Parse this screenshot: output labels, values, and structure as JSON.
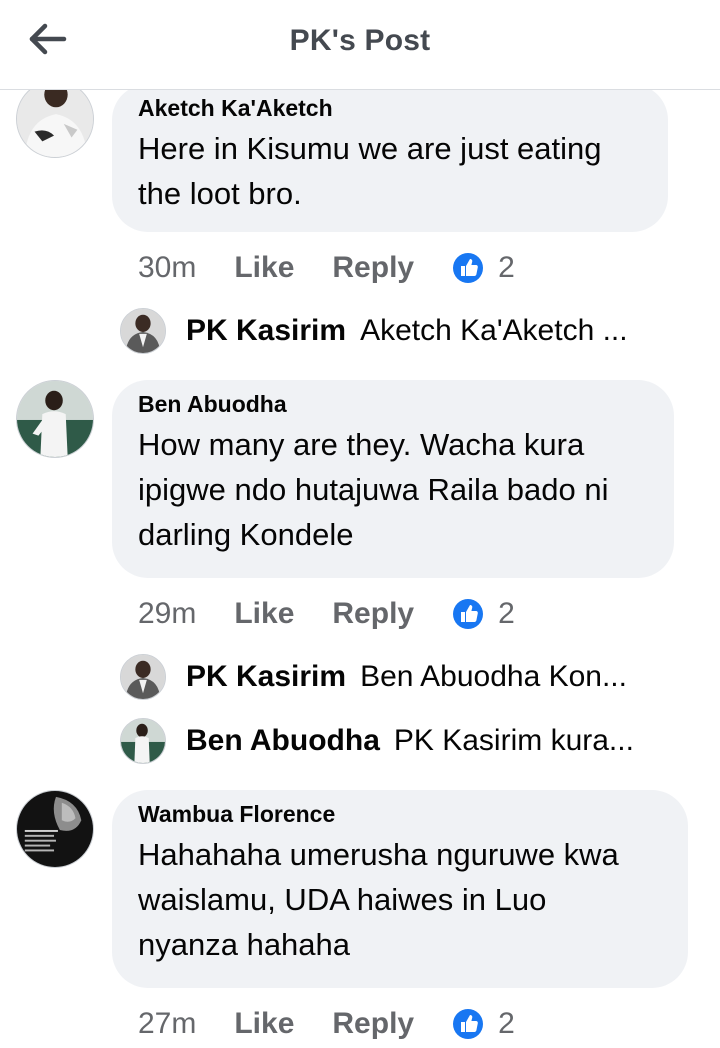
{
  "header": {
    "title": "PK's Post"
  },
  "comments": [
    {
      "author": "Aketch Ka'Aketch",
      "text_lines": [
        "Here in Kisumu we are just eating",
        "the loot bro."
      ],
      "time": "30m",
      "like": "Like",
      "reply": "Reply",
      "reactions": "2",
      "replies": [
        {
          "name": "PK Kasirim",
          "text": "Aketch Ka'Aketch ..."
        }
      ]
    },
    {
      "author": "Ben Abuodha",
      "text_lines": [
        "How many are they. Wacha kura",
        "ipigwe ndo hutajuwa Raila bado ni",
        "darling Kondele"
      ],
      "time": "29m",
      "like": "Like",
      "reply": "Reply",
      "reactions": "2",
      "replies": [
        {
          "name": "PK Kasirim",
          "text": "Ben Abuodha Kon..."
        },
        {
          "name": "Ben Abuodha",
          "text": "PK Kasirim kura..."
        }
      ]
    },
    {
      "author": "Wambua Florence",
      "text_lines": [
        "Hahahaha umerusha nguruwe kwa",
        "waislamu, UDA haiwes in Luo",
        "nyanza hahaha"
      ],
      "time": "27m",
      "like": "Like",
      "reply": "Reply",
      "reactions": "2",
      "replies": []
    }
  ],
  "colors": {
    "bubble": "#f0f2f5",
    "meta": "#65676b",
    "like_icon": "#1877f2",
    "header_text": "#444950"
  },
  "icons": {
    "back": "arrow-left-icon",
    "reaction": "thumbs-up-reaction-icon"
  }
}
